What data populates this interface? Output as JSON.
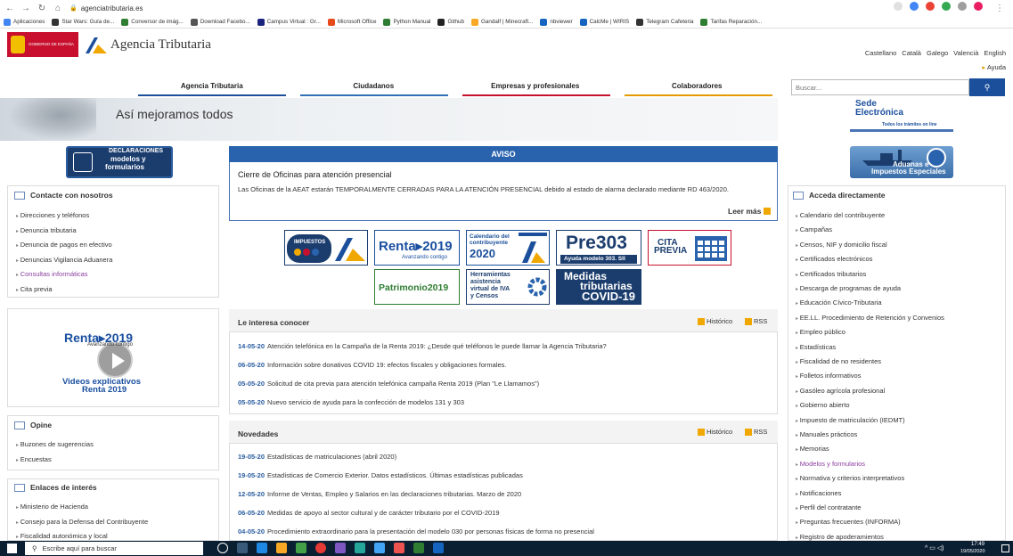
{
  "browser": {
    "url": "agenciatributaria.es",
    "bookmarks": [
      {
        "label": "Aplicaciones",
        "color": "#4285f4"
      },
      {
        "label": "Star Wars: Guía de...",
        "color": "#333333"
      },
      {
        "label": "Conversor de imág...",
        "color": "#2e7d32"
      },
      {
        "label": "Download Facebo...",
        "color": "#555555"
      },
      {
        "label": "Campus Virtual : Gr...",
        "color": "#1a237e"
      },
      {
        "label": "Microsoft Office",
        "color": "#e64a19"
      },
      {
        "label": "Python Manual",
        "color": "#2e7d32"
      },
      {
        "label": "Github",
        "color": "#222222"
      },
      {
        "label": "Gandalf | Minecraft...",
        "color": "#f9a825"
      },
      {
        "label": "nbviewer",
        "color": "#1565c0"
      },
      {
        "label": "CalcMe | WIRIS",
        "color": "#1565c0"
      },
      {
        "label": "Telegram Cafeteria",
        "color": "#333333"
      },
      {
        "label": "Tarifas Reparación...",
        "color": "#2e7d32"
      }
    ]
  },
  "header": {
    "gov_label": "GOBIERNO DE ESPAÑA",
    "site_title": "Agencia Tributaria",
    "languages": [
      "Castellano",
      "Català",
      "Galego",
      "Valencià",
      "English"
    ],
    "help": "Ayuda"
  },
  "topnav": {
    "tabs": [
      {
        "label": "Agencia Tributaria",
        "color": "#1b4f9c"
      },
      {
        "label": "Ciudadanos",
        "color": "#2f6fb5"
      },
      {
        "label": "Empresas y profesionales",
        "color": "#c8102e"
      },
      {
        "label": "Colaboradores",
        "color": "#e29b00"
      }
    ],
    "search_placeholder": "Buscar..."
  },
  "hero": {
    "slogan": "Así mejoramos todos",
    "sede_l1": "Sede",
    "sede_l2": "Electrónica",
    "sede_l3": "Todos los trámites on line"
  },
  "left": {
    "decl_l1": "DECLARACIONES",
    "decl_l2": "modelos y",
    "decl_l3": "formularios",
    "contact_title": "Contacte con nosotros",
    "contact_links": [
      "Direcciones y teléfonos",
      "Denuncia tributaria",
      "Denuncia de pagos en efectivo",
      "Denuncias Vigilancia Aduanera",
      "Consultas informáticas",
      "Cita previa"
    ],
    "renta_title": "Renta▸2019",
    "renta_sub": "Avanzando contigo",
    "renta_video_l1": "Videos explicativos",
    "renta_video_l2": "Renta 2019",
    "opine_title": "Opine",
    "opine_links": [
      "Buzones de sugerencias",
      "Encuestas"
    ],
    "enlaces_title": "Enlaces de interés",
    "enlaces_links": [
      "Ministerio de Hacienda",
      "Consejo para la Defensa del Contribuyente",
      "Fiscalidad autonómica y local"
    ]
  },
  "aviso": {
    "header": "AVISO",
    "title": "Cierre de Oficinas para atención presencial",
    "text": "Las Oficinas de la AEAT estarán TEMPORALMENTE CERRADAS PARA LA ATENCIÓN PRESENCIAL debido al estado de alarma declarado mediante RD 463/2020.",
    "more": "Leer más"
  },
  "tiles": {
    "impuestos": "IMPUESTOS",
    "renta": "Renta▸2019",
    "renta_sub": "Avanzando contigo",
    "calendario_l1": "Calendario del",
    "calendario_l2": "contribuyente",
    "calendario_l3": "2020",
    "pre303": "Pre303",
    "pre303_sub": "Ayuda modelo 303. SII",
    "cita_l1": "CITA",
    "cita_l2": "PREVIA",
    "patrimonio": "Patrimonio2019",
    "herr_l1": "Herramientas",
    "herr_l2": "asistencia",
    "herr_l3": "virtual de IVA",
    "herr_l4": "y Censos",
    "covid_l1": "Medidas",
    "covid_l2": "tributarias",
    "covid_l3": "COVID-19"
  },
  "interesa": {
    "title": "Le interesa conocer",
    "historico": "Histórico",
    "rss": "RSS",
    "items": [
      {
        "date": "14-05-20",
        "text": "Atención telefónica en la Campaña de la Renta 2019: ¿Desde qué teléfonos le puede llamar la Agencia Tributaria?"
      },
      {
        "date": "06-05-20",
        "text": "Información sobre donativos COVID 19: efectos fiscales y obligaciones formales."
      },
      {
        "date": "05-05-20",
        "text": "Solicitud de cita previa para atención telefónica campaña Renta 2019 (Plan \"Le Llamamos\")"
      },
      {
        "date": "05-05-20",
        "text": "Nuevo servicio de ayuda para la confección de modelos 131 y 303"
      }
    ]
  },
  "novedades": {
    "title": "Novedades",
    "historico": "Histórico",
    "rss": "RSS",
    "items": [
      {
        "date": "19-05-20",
        "text": "Estadísticas de matriculaciones (abril 2020)"
      },
      {
        "date": "19-05-20",
        "text": "Estadísticas de Comercio Exterior. Datos estadísticos. Últimas estadísticas publicadas"
      },
      {
        "date": "12-05-20",
        "text": "Informe de Ventas, Empleo y Salarios en las declaraciones tributarias. Marzo de 2020"
      },
      {
        "date": "06-05-20",
        "text": "Medidas de apoyo al sector cultural y de carácter tributario por el COVID-2019"
      },
      {
        "date": "04-05-20",
        "text": "Procedimiento extraordinario para la presentación del modelo 030 por personas físicas de forma no presencial"
      }
    ]
  },
  "right": {
    "aduanas_l1": "Aduanas e",
    "aduanas_l2": "Impuestos Especiales",
    "acceda_title": "Acceda directamente",
    "acceda_links": [
      "Calendario del contribuyente",
      "Campañas",
      "Censos, NIF y domicilio fiscal",
      "Certificados electrónicos",
      "Certificados tributarios",
      "Descarga de programas de ayuda",
      "Educación Cívico-Tributaria",
      "EE.LL. Procedimiento de Retención y Convenios",
      "Empleo público",
      "Estadísticas",
      "Fiscalidad de no residentes",
      "Folletos informativos",
      "Gasóleo agrícola profesional",
      "Gobierno abierto",
      "Impuesto de matriculación (IEDMT)",
      "Manuales prácticos",
      "Memorias",
      "Modelos y formularios",
      "Normativa y criterios interpretativos",
      "Notificaciones",
      "Perfil del contratante",
      "Preguntas frecuentes (INFORMA)",
      "Registro de apoderamientos"
    ]
  },
  "taskbar": {
    "search": "Escribe aquí para buscar",
    "time": "17:49",
    "date": "19/05/2020"
  },
  "colors": {
    "brand_blue": "#1b4f9c",
    "aviso_blue": "#2a63ad",
    "accent_orange": "#f0a800",
    "visited": "#8b3fa0"
  }
}
